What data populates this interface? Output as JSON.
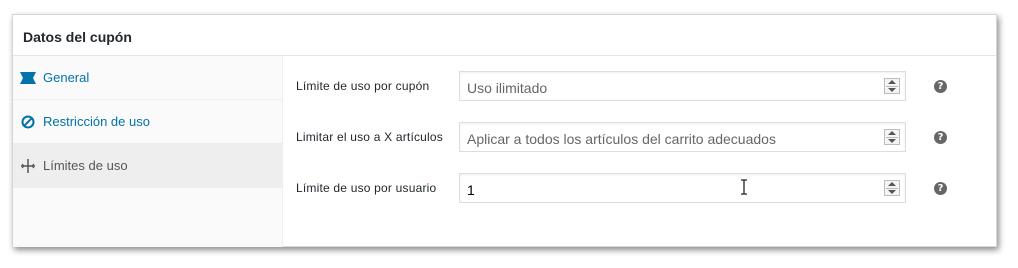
{
  "panel": {
    "title": "Datos del cupón"
  },
  "tabs": [
    {
      "label": "General",
      "icon": "ticket-icon",
      "active": false,
      "color": "#0073aa"
    },
    {
      "label": "Restricción de uso",
      "icon": "ban-icon",
      "active": false,
      "color": "#0073aa"
    },
    {
      "label": "Límites de uso",
      "icon": "limits-icon",
      "active": true,
      "color": "#555555"
    }
  ],
  "fields": [
    {
      "label": "Límite de uso por cupón",
      "value": "",
      "placeholder": "Uso ilimitado"
    },
    {
      "label": "Limitar el uso a X artículos",
      "value": "",
      "placeholder": "Aplicar a todos los artículos del carrito adecuados"
    },
    {
      "label": "Límite de uso por usuario",
      "value": "1",
      "placeholder": ""
    }
  ],
  "help": {
    "glyph": "?"
  }
}
